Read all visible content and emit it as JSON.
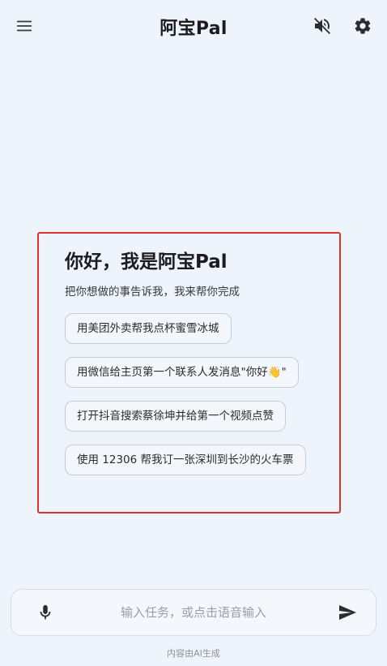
{
  "header": {
    "title": "阿宝Pal",
    "menu_icon": "menu-icon",
    "mute_icon": "volume-off-icon",
    "settings_icon": "gear-icon"
  },
  "welcome": {
    "greeting": "你好，我是阿宝Pal",
    "subtitle": "把你想做的事告诉我，我来帮你完成",
    "suggestions": [
      "用美团外卖帮我点杯蜜雪冰城",
      "用微信给主页第一个联系人发消息\"你好👋\"",
      "打开抖音搜索蔡徐坤并给第一个视频点赞",
      "使用 12306 帮我订一张深圳到长沙的火车票"
    ]
  },
  "input": {
    "placeholder": "输入任务，或点击语音输入",
    "value": "",
    "mic_icon": "microphone-icon",
    "send_icon": "send-icon"
  },
  "footer": {
    "note": "内容由AI生成"
  },
  "colors": {
    "background": "#eef4fc",
    "highlight_border": "#e0302c",
    "chip_border": "#c7ccd4",
    "text_primary": "#1c1c1e"
  }
}
